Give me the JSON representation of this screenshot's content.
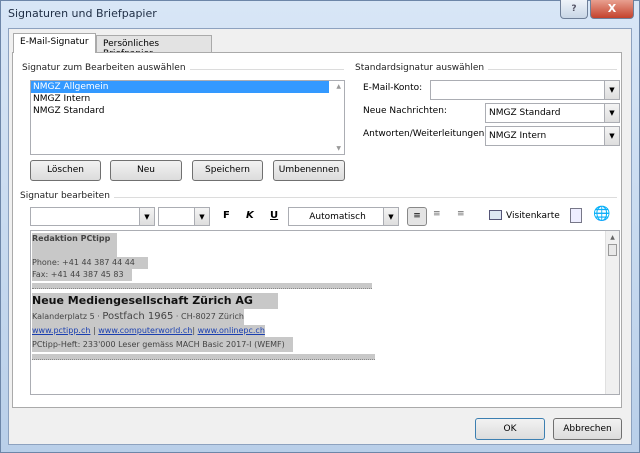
{
  "window": {
    "title": "Signaturen und Briefpapier",
    "help": "?",
    "close": "X"
  },
  "tabs": [
    {
      "label": "E-Mail-Signatur",
      "active": true
    },
    {
      "label": "Persönliches Briefpapier",
      "active": false
    }
  ],
  "select_group": {
    "label": "Signatur zum Bearbeiten auswählen",
    "items": [
      "NMGZ Allgemein",
      "NMGZ Intern",
      "NMGZ Standard"
    ],
    "selected": "NMGZ Allgemein",
    "buttons": {
      "delete": "Löschen",
      "new": "Neu",
      "save": "Speichern",
      "rename": "Umbenennen"
    }
  },
  "default_group": {
    "label": "Standardsignatur auswählen",
    "account_label": "E-Mail-Konto:",
    "account_value": "",
    "new_label": "Neue Nachrichten:",
    "new_value": "NMGZ Standard",
    "reply_label": "Antworten/Weiterleitungen:",
    "reply_value": "NMGZ Intern"
  },
  "edit_group": {
    "label": "Signatur bearbeiten",
    "font_value": "",
    "size_value": "",
    "bold": "F",
    "italic": "K",
    "underline": "U",
    "color_value": "Automatisch",
    "business_card": "Visitenkarte"
  },
  "signature": {
    "line1": "Redaktion PCtipp",
    "phone": "Phone: +41 44 387 44 44",
    "fax": "Fax: +41 44 387 45 83",
    "company": "Neue Mediengesellschaft Zürich AG",
    "addr1": "Kalanderplatz 5",
    "addr2": "Postfach 1965",
    "addr3": "CH-8027 Zürich",
    "link1": "www.pctipp.ch",
    "link2": "www.computerworld.ch",
    "link3": "www.onlinepc.ch",
    "sep": "|",
    "footer": "PCtipp-Heft: 233'000 Leser gemäss MACH Basic 2017-I (WEMF)"
  },
  "footer": {
    "ok": "OK",
    "cancel": "Abbrechen"
  }
}
